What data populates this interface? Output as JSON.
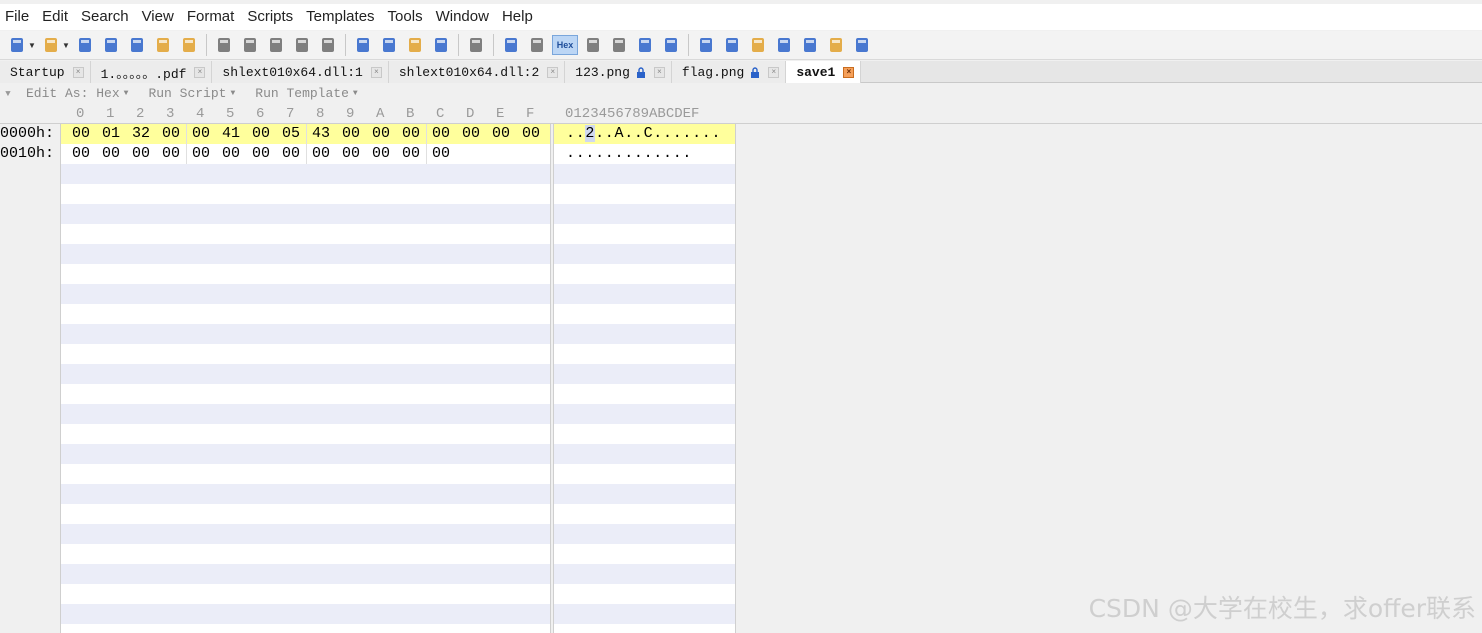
{
  "menu": [
    "File",
    "Edit",
    "Search",
    "View",
    "Format",
    "Scripts",
    "Templates",
    "Tools",
    "Window",
    "Help"
  ],
  "toolbar": {
    "icons": [
      "new-file-icon",
      "open-file-icon",
      "save-icon",
      "save-as-icon",
      "save-all-icon",
      "open-folder-icon",
      "close-all-icon",
      "cut-icon",
      "copy-icon",
      "paste-icon",
      "undo-icon",
      "redo-icon",
      "find-icon",
      "replace-icon",
      "find-in-files-icon",
      "goto-icon",
      "print-icon",
      "font-icon",
      "highlight-icon",
      "hex-mode-icon",
      "columns-icon",
      "pilcrow-icon",
      "line-view-icon",
      "binary-view-icon",
      "calculator-icon",
      "template-icon",
      "compare-icon",
      "tools-icon",
      "histogram-icon",
      "checksum-icon",
      "base-converter-icon"
    ],
    "hex_label": "Hex"
  },
  "tabs": [
    {
      "label": "Startup",
      "locked": false,
      "active": false
    },
    {
      "label": "1.。。。。。.pdf",
      "locked": false,
      "active": false
    },
    {
      "label": "shlext010x64.dll:1",
      "locked": false,
      "active": false
    },
    {
      "label": "shlext010x64.dll:2",
      "locked": false,
      "active": false
    },
    {
      "label": "123.png",
      "locked": true,
      "active": false
    },
    {
      "label": "flag.png",
      "locked": true,
      "active": false
    },
    {
      "label": "save1",
      "locked": false,
      "active": true
    }
  ],
  "editor_bar": {
    "edit_as": "Edit As: Hex",
    "run_script": "Run Script",
    "run_template": "Run Template"
  },
  "columns": {
    "hex": [
      "0",
      "1",
      "2",
      "3",
      "4",
      "5",
      "6",
      "7",
      "8",
      "9",
      "A",
      "B",
      "C",
      "D",
      "E",
      "F"
    ],
    "ascii": "0123456789ABCDEF"
  },
  "rows": [
    {
      "addr": "0000h:",
      "hex": [
        "00",
        "01",
        "32",
        "00",
        "00",
        "41",
        "00",
        "05",
        "43",
        "00",
        "00",
        "00",
        "00",
        "00",
        "00",
        "00"
      ],
      "ascii": "..2..A..C......."
    },
    {
      "addr": "0010h:",
      "hex": [
        "00",
        "00",
        "00",
        "00",
        "00",
        "00",
        "00",
        "00",
        "00",
        "00",
        "00",
        "00",
        "00"
      ],
      "ascii": "............."
    }
  ],
  "watermark": "CSDN @大学在校生，求offer联系"
}
